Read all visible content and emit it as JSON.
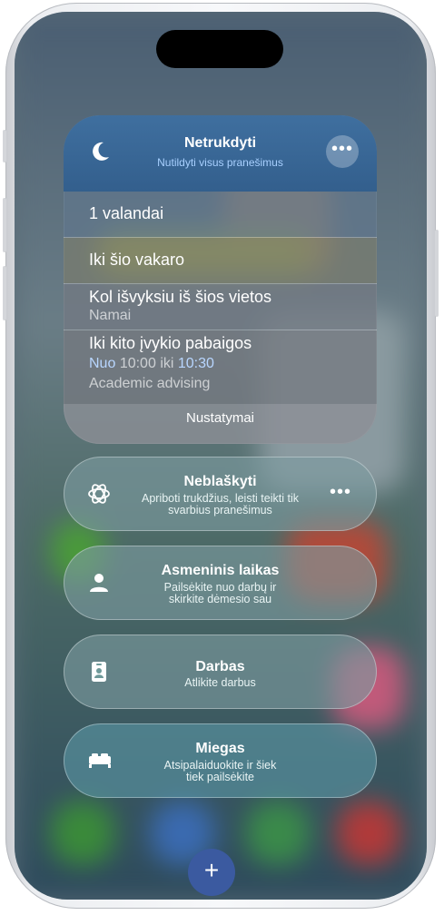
{
  "dnd": {
    "title": "Netrukdyti",
    "subtitle": "Nutildyti visus pranešimus",
    "icon": "moon-icon",
    "more_icon": "ellipsis-icon",
    "options": [
      {
        "label": "1 valandai"
      },
      {
        "label": "Iki šio vakaro"
      },
      {
        "label": "Kol išvyksiu iš šios vietos",
        "sub": "Namai"
      },
      {
        "label": "Iki kito įvykio pabaigos",
        "time_prefix": "Nuo",
        "time_mid": "10:00",
        "time_sep": "iki",
        "time_end": "10:30",
        "event": "Academic advising"
      }
    ],
    "settings_label": "Nustatymai"
  },
  "focus_modes": [
    {
      "title": "Neblaškyti",
      "subtitle_line1": "Apriboti trukdžius, leisti teikti tik",
      "subtitle_line2": "svarbius pranešimus",
      "icon": "reduce-interruptions-icon",
      "more": "•••"
    },
    {
      "title": "Asmeninis laikas",
      "subtitle_line1": "Pailsėkite nuo darbų ir",
      "subtitle_line2": "skirkite dėmesio sau",
      "icon": "person-icon"
    },
    {
      "title": "Darbas",
      "subtitle_line1": "Atlikite darbus",
      "subtitle_line2": "",
      "icon": "id-badge-icon"
    },
    {
      "title": "Miegas",
      "subtitle_line1": "Atsipalaiduokite ir šiek",
      "subtitle_line2": "tiek pailsėkite",
      "icon": "bed-icon"
    }
  ],
  "add_button": "+",
  "colors": {
    "dnd_header": "#3f6f9f",
    "dnd_subtitle": "#a8d0ff",
    "add_button": "#3b5aa0"
  }
}
